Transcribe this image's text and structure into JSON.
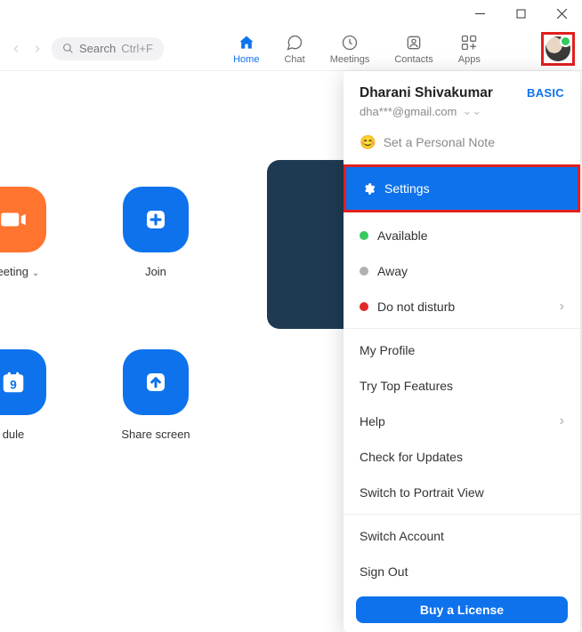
{
  "window": {
    "minimize": "–",
    "maximize": "◻",
    "close": "✕"
  },
  "toolbar": {
    "search_placeholder": "Search",
    "search_shortcut": "Ctrl+F"
  },
  "nav": {
    "home": "Home",
    "chat": "Chat",
    "meetings": "Meetings",
    "contacts": "Contacts",
    "apps": "Apps"
  },
  "tiles": {
    "new_meeting": "Meeting",
    "join": "Join",
    "schedule": "dule",
    "share_screen": "Share screen",
    "schedule_day": "9"
  },
  "menu": {
    "name": "Dharani Shivakumar",
    "plan": "BASIC",
    "email": "dha***@gmail.com",
    "personal_note": "Set a Personal Note",
    "settings": "Settings",
    "available": "Available",
    "away": "Away",
    "dnd": "Do not disturb",
    "my_profile": "My Profile",
    "top_features": "Try Top Features",
    "help": "Help",
    "check_updates": "Check for Updates",
    "portrait": "Switch to Portrait View",
    "switch_account": "Switch Account",
    "sign_out": "Sign Out",
    "buy": "Buy a License"
  }
}
